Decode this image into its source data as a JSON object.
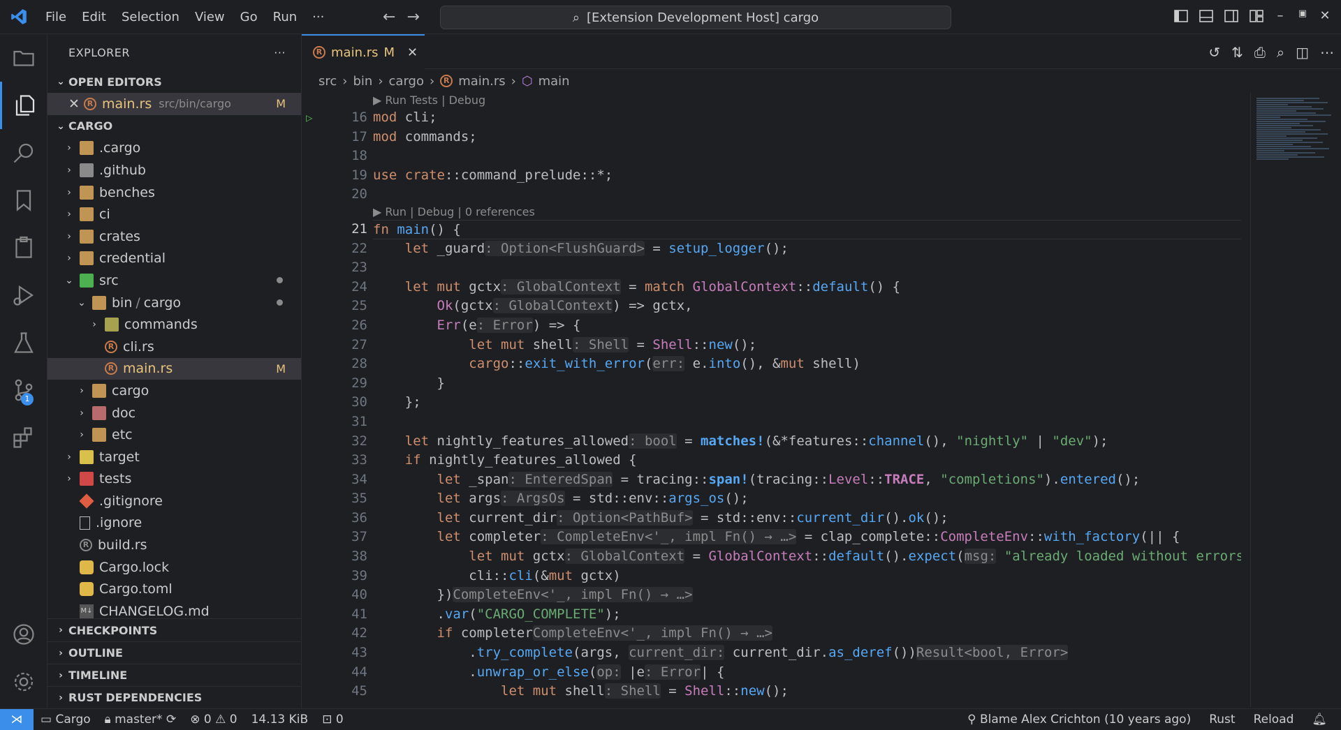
{
  "titlebar": {
    "menu": [
      "File",
      "Edit",
      "Selection",
      "View",
      "Go",
      "Run",
      "···"
    ],
    "command_center": "[Extension Development Host] cargo"
  },
  "sidebar": {
    "title": "EXPLORER",
    "more": "···",
    "open_editors": {
      "label": "OPEN EDITORS",
      "file": "main.rs",
      "path": "src/bin/cargo",
      "status": "M"
    },
    "workspace": "CARGO",
    "tree": [
      {
        "label": ".cargo"
      },
      {
        "label": ".github"
      },
      {
        "label": "benches"
      },
      {
        "label": "ci"
      },
      {
        "label": "crates"
      },
      {
        "label": "credential"
      },
      {
        "label": "src"
      },
      {
        "label": "bin"
      },
      {
        "label": "cargo"
      },
      {
        "label": "commands"
      },
      {
        "label": "cli.rs"
      },
      {
        "label": "main.rs",
        "status": "M"
      },
      {
        "label": "cargo"
      },
      {
        "label": "doc"
      },
      {
        "label": "etc"
      },
      {
        "label": "target"
      },
      {
        "label": "tests"
      },
      {
        "label": ".gitignore"
      },
      {
        "label": ".ignore"
      },
      {
        "label": "build.rs"
      },
      {
        "label": "Cargo.lock"
      },
      {
        "label": "Cargo.toml"
      },
      {
        "label": "CHANGELOG.md"
      }
    ],
    "bottom_sections": [
      "CHECKPOINTS",
      "OUTLINE",
      "TIMELINE",
      "RUST DEPENDENCIES"
    ]
  },
  "editor": {
    "tab": {
      "name": "main.rs",
      "status": "M"
    },
    "breadcrumbs": [
      "src",
      "bin",
      "cargo",
      "main.rs",
      "main"
    ],
    "lens_top": "▶ Run Tests | Debug",
    "lens_main": "▶ Run | Debug | 0 references",
    "line_numbers": [
      "16",
      "17",
      "18",
      "19",
      "20",
      "21",
      "22",
      "23",
      "24",
      "25",
      "26",
      "27",
      "28",
      "29",
      "30",
      "31",
      "32",
      "33",
      "34",
      "35",
      "36",
      "37",
      "38",
      "39",
      "40",
      "41",
      "42",
      "43",
      "44",
      "45"
    ]
  },
  "statusbar": {
    "project": "Cargo",
    "branch": "master*",
    "errors": "0",
    "warnings": "0",
    "size": "14.13 KiB",
    "ports": "0",
    "blame": "Blame Alex Crichton (10 years ago)",
    "language": "Rust",
    "reload": "Reload"
  },
  "badges": {
    "source_control": "1"
  },
  "colors": {
    "accent": "#3b8eea",
    "modified": "#e8c47c",
    "background": "#1e1f22"
  }
}
